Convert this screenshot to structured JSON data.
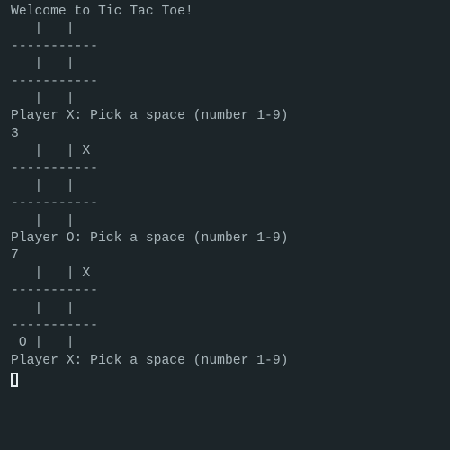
{
  "terminal": {
    "lines": [
      "Welcome to Tic Tac Toe!",
      "   |   |",
      "-----------",
      "   |   |",
      "-----------",
      "   |   |",
      "Player X: Pick a space (number 1-9)",
      "3",
      "   |   | X",
      "-----------",
      "   |   |",
      "-----------",
      "   |   |",
      "Player O: Pick a space (number 1-9)",
      "7",
      "   |   | X",
      "-----------",
      "   |   |",
      "-----------",
      " O |   |",
      "Player X: Pick a space (number 1-9)"
    ]
  },
  "colors": {
    "background": "#1c2529",
    "text": "#a9b6bb",
    "cursor": "#e7eef0"
  }
}
